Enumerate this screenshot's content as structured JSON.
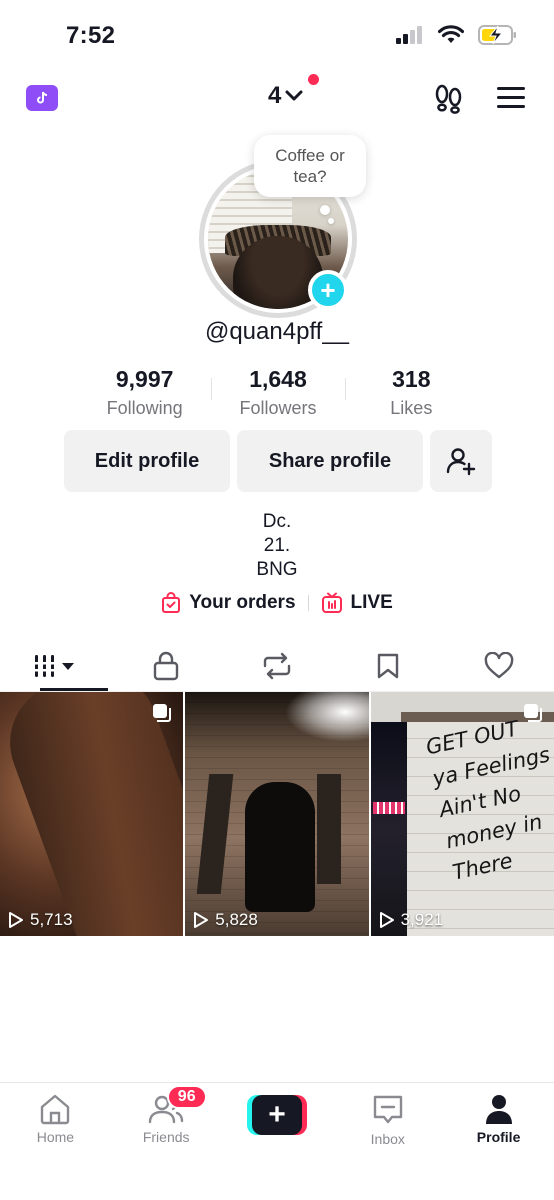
{
  "status_bar": {
    "time": "7:52",
    "icons": [
      "signal-icon",
      "wifi-icon",
      "battery-charging-icon"
    ],
    "battery_color": "#ffd60a"
  },
  "top_nav": {
    "account_label": "4",
    "icons": [
      "ticket-icon",
      "chevron-down-icon",
      "footprints-icon",
      "menu-icon"
    ],
    "accent": "#8e4df6",
    "notification_color": "#fe2c55"
  },
  "profile": {
    "note_bubble": "Coffee or tea?",
    "username": "@quan4pff__",
    "add_color": "#20d5ec"
  },
  "stats": [
    {
      "value": "9,997",
      "label": "Following"
    },
    {
      "value": "1,648",
      "label": "Followers"
    },
    {
      "value": "318",
      "label": "Likes"
    }
  ],
  "actions": {
    "edit_label": "Edit profile",
    "share_label": "Share profile",
    "add_friend_icon": "add-user-icon"
  },
  "bio": [
    "Dc.",
    "21.",
    "BNG"
  ],
  "links": [
    {
      "label": "Your orders",
      "icon": "shopping-bag-icon"
    },
    {
      "label": "LIVE",
      "icon": "live-tv-icon"
    }
  ],
  "tabs": [
    {
      "icon": "grid-icon",
      "active": true
    },
    {
      "icon": "lock-icon",
      "active": false
    },
    {
      "icon": "repost-icon",
      "active": false
    },
    {
      "icon": "bookmark-icon",
      "active": false
    },
    {
      "icon": "heart-icon",
      "active": false
    }
  ],
  "videos": [
    {
      "views": "5,713",
      "multi": true
    },
    {
      "views": "5,828",
      "multi": false
    },
    {
      "views": "3,921",
      "multi": true,
      "graffiti": [
        "GET OUT",
        "ya Feelings",
        "Ain't No",
        "money in",
        "There"
      ]
    }
  ],
  "bottom_nav": [
    {
      "label": "Home",
      "icon": "home-icon"
    },
    {
      "label": "Friends",
      "icon": "friends-icon",
      "badge": "96"
    },
    {
      "label": "",
      "icon": "plus-icon"
    },
    {
      "label": "Inbox",
      "icon": "inbox-icon"
    },
    {
      "label": "Profile",
      "icon": "person-icon",
      "active": true
    }
  ]
}
